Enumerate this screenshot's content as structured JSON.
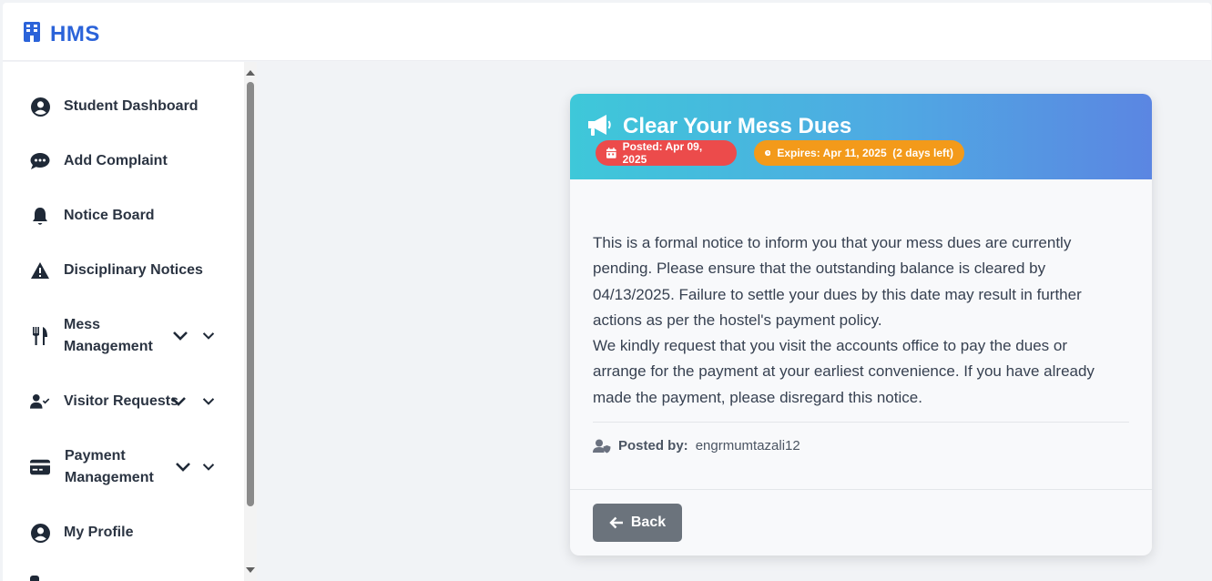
{
  "app": {
    "brand": "HMS"
  },
  "sidebar": {
    "items": [
      {
        "label": "Student Dashboard",
        "icon": "user-circle-icon"
      },
      {
        "label": "Add Complaint",
        "icon": "chat-icon"
      },
      {
        "label": "Notice Board",
        "icon": "bell-icon"
      },
      {
        "label": "Disciplinary Notices",
        "icon": "warning-icon"
      },
      {
        "label": "Mess Management",
        "icon": "utensils-icon"
      },
      {
        "label": "Visitor Requests",
        "icon": "user-check-icon"
      },
      {
        "label": "Payment Management",
        "icon": "credit-card-icon"
      },
      {
        "label": "My Profile",
        "icon": "user-circle-icon"
      }
    ]
  },
  "notice": {
    "title": "Clear Your Mess Dues",
    "posted": "Posted: Apr 09, 2025",
    "expires": "Expires: Apr 11, 2025  (2 days left)",
    "paragraph1": "This is a formal notice to inform you that your mess dues are currently pending. Please ensure that the outstanding balance is cleared by 04/13/2025. Failure to settle your dues by this date may result in further actions as per the hostel's payment policy.",
    "paragraph2": "We kindly request that you visit the accounts office to pay the dues or arrange for the payment at your earliest convenience. If you have already made the payment, please disregard this notice.",
    "posted_by_label": "Posted by:",
    "posted_by_value": "engrmumtazali12",
    "back_label": "Back"
  },
  "colors": {
    "brand": "#2b63d9",
    "badge_posted": "#ec4b4b",
    "badge_expires": "#f39a1a",
    "header_gradient_start": "#3ec8d9",
    "header_gradient_end": "#5b86e2",
    "back_button": "#6b737c"
  }
}
